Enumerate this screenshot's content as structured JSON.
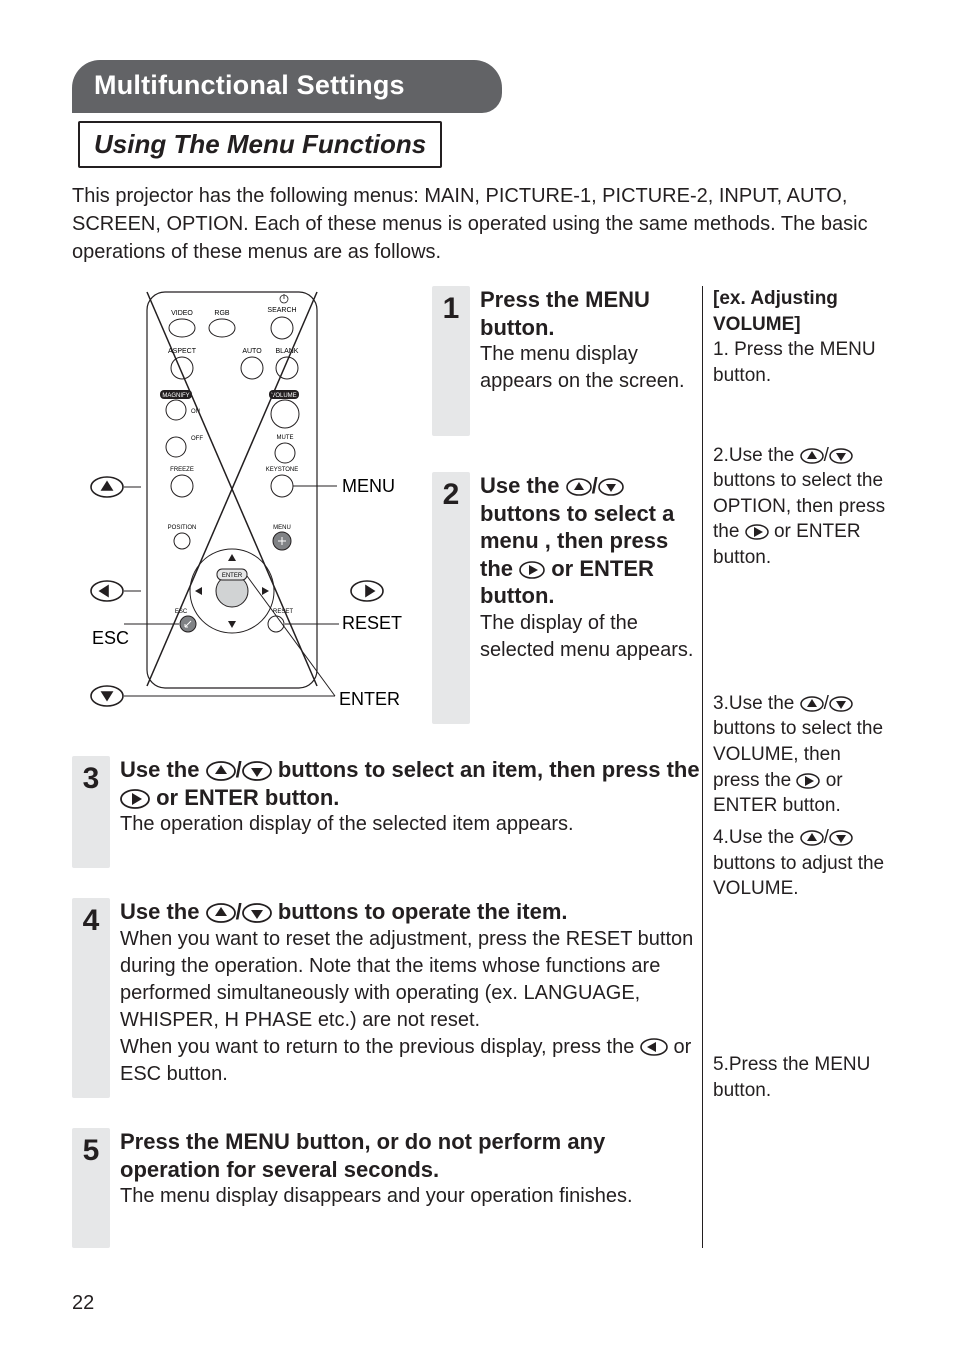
{
  "page": {
    "number": "22",
    "title": "Multifunctional Settings",
    "subtitle": "Using The Menu Functions",
    "intro": "This projector has the following menus: MAIN, PICTURE-1, PICTURE-2, INPUT, AUTO, SCREEN, OPTION. Each of these menus is operated using the same methods. The basic operations of these menus are as follows."
  },
  "remote": {
    "btn_video": "VIDEO",
    "btn_rgb": "RGB",
    "btn_search": "SEARCH",
    "btn_aspect": "ASPECT",
    "btn_auto": "AUTO",
    "btn_blank": "BLANK",
    "btn_magnify": "MAGNIFY",
    "btn_on": "ON",
    "btn_off": "OFF",
    "btn_volume": "VOLUME",
    "btn_mute": "MUTE",
    "btn_freeze": "FREEZE",
    "btn_keystone": "KEYSTONE",
    "btn_position": "POSITION",
    "btn_menu": "MENU",
    "btn_enter": "ENTER",
    "btn_esc": "ESC",
    "btn_reset": "RESET",
    "label_menu": "MENU",
    "label_reset": "RESET",
    "label_esc": "ESC",
    "label_enter": "ENTER"
  },
  "steps": {
    "s1": {
      "n": "1",
      "title": "Press the MENU button.",
      "desc": "The menu display appears on the screen."
    },
    "s2": {
      "n": "2",
      "title_a": "Use the ",
      "title_b": " buttons to select a menu , then press the ",
      "title_c": " or ENTER button.",
      "desc": "The display of the selected menu appears."
    },
    "s3": {
      "n": "3",
      "title_a": "Use the ",
      "title_b": " buttons to select an item, then press the ",
      "title_c": " or ENTER button.",
      "desc": "The operation display of the selected item appears."
    },
    "s4": {
      "n": "4",
      "title_a": "Use the ",
      "title_b": " buttons to operate the item.",
      "desc_a": "When you want to reset the adjustment, press the RESET button during the operation. Note that the items whose functions are performed simultaneously with operating (ex. LANGUAGE, WHISPER, H PHASE etc.) are not reset.",
      "desc_b": "When you want to return to the previous display, press the ",
      "desc_c": " or ESC button."
    },
    "s5": {
      "n": "5",
      "title": "Press the MENU button, or do not perform any operation for several seconds.",
      "desc": "The menu display disappears and your operation finishes."
    }
  },
  "example": {
    "hdr": "[ex. Adjusting VOLUME]",
    "e1": "1. Press the MENU button.",
    "e2a": "2.Use the ",
    "e2b": " buttons to select the OPTION, then press the ",
    "e2c": " or ENTER button.",
    "e3a": "3.Use the ",
    "e3b": " buttons to select the VOLUME, then press the ",
    "e3c": " or ENTER button.",
    "e4a": "4.Use the ",
    "e4b": " buttons to adjust the VOLUME.",
    "e5": "5.Press the MENU button."
  }
}
